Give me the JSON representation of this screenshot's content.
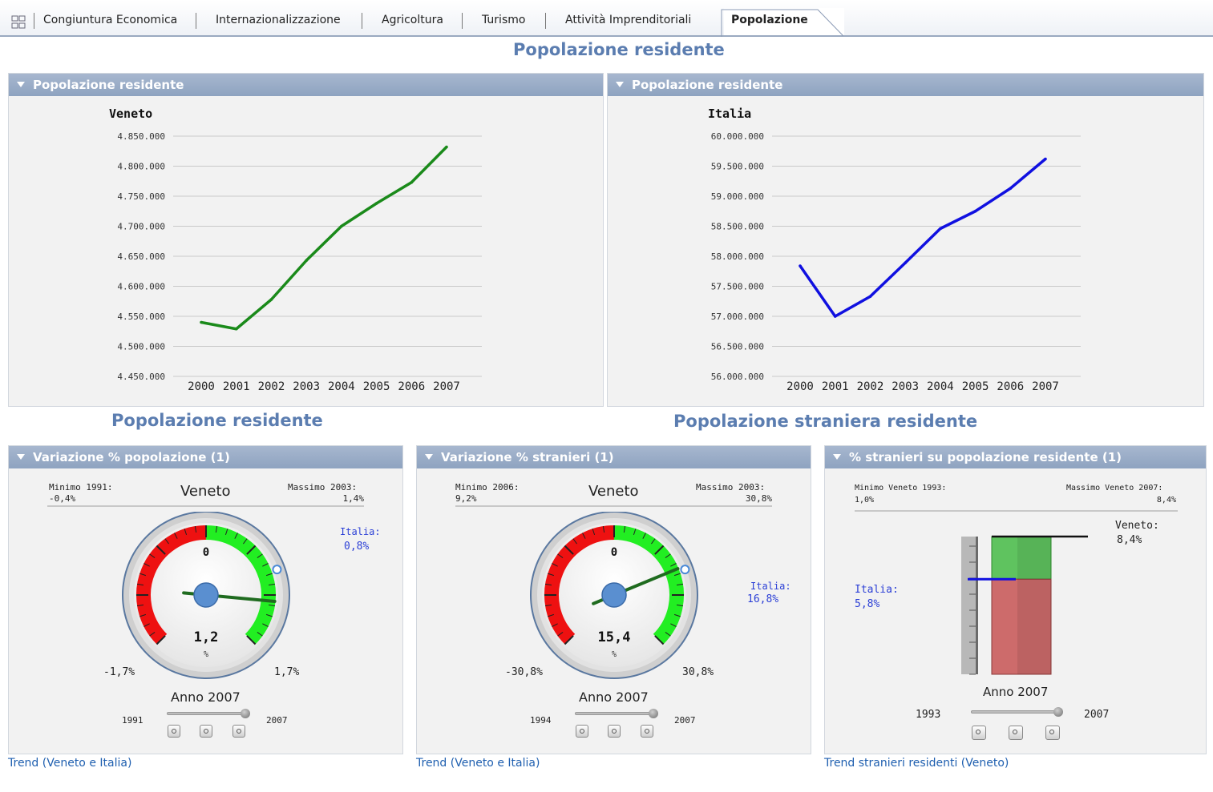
{
  "tabs": [
    {
      "label": "Congiuntura Economica"
    },
    {
      "label": "Internazionalizzazione"
    },
    {
      "label": "Agricoltura"
    },
    {
      "label": "Turismo"
    },
    {
      "label": "Attività Imprenditoriali"
    },
    {
      "label": "Popolazione"
    }
  ],
  "active_tab": "Popolazione",
  "headings": {
    "top": "Popolazione residente",
    "left": "Popolazione residente",
    "right": "Popolazione straniera residente"
  },
  "panels": {
    "chart_veneto_title": "Popolazione residente",
    "chart_italia_title": "Popolazione residente",
    "gauge1_title": "Variazione % popolazione (1)",
    "gauge2_title": "Variazione % stranieri (1)",
    "bar_title": "% stranieri su popolazione residente (1)"
  },
  "gauge1": {
    "min_label": "Minimo 1991:",
    "min_value": "-0,4%",
    "max_label": "Massimo 2003:",
    "max_value": "1,4%",
    "region": "Veneto",
    "italia_label": "Italia:",
    "italia_value": "0,8%",
    "zero": "0",
    "value": "1,2",
    "unit": "%",
    "scale_min": "-1,7%",
    "scale_max": "1,7%",
    "year_label": "Anno 2007",
    "slider_start": "1991",
    "slider_end": "2007",
    "needle_fraction": 0.853,
    "link": "Trend (Veneto e Italia)"
  },
  "gauge2": {
    "min_label": "Minimo 2006:",
    "min_value": "9,2%",
    "max_label": "Massimo 2003:",
    "max_value": "30,8%",
    "region": "Veneto",
    "italia_label": "Italia:",
    "italia_value": "16,8%",
    "zero": "0",
    "value": "15,4",
    "unit": "%",
    "scale_min": "-30,8%",
    "scale_max": "30,8%",
    "year_label": "Anno 2007",
    "slider_start": "1994",
    "slider_end": "2007",
    "needle_fraction": 0.75,
    "link": "Trend (Veneto e Italia)"
  },
  "barpanel": {
    "min_label": "Minimo Veneto 1993:",
    "min_value": "1,0%",
    "max_label": "Massimo Veneto 2007:",
    "max_value": "8,4%",
    "veneto_label": "Veneto:",
    "veneto_value": "8,4%",
    "italia_label": "Italia:",
    "italia_value": "5,8%",
    "year_label": "Anno 2007",
    "slider_start": "1993",
    "slider_end": "2007",
    "veneto_pct": 8.4,
    "italia_pct": 5.8,
    "link": "Trend stranieri residenti (Veneto)"
  },
  "colors": {
    "veneto_line": "#1a8a1a",
    "italia_line": "#1010e0",
    "heading": "#5b7db0",
    "gauge_red": "#ee1111",
    "gauge_green": "#22ee22"
  },
  "chart_data": [
    {
      "type": "line",
      "title": "Veneto",
      "categories": [
        "2000",
        "2001",
        "2002",
        "2003",
        "2004",
        "2005",
        "2006",
        "2007"
      ],
      "series": [
        {
          "values": [
            4540000,
            4529000,
            4578000,
            4643000,
            4700000,
            4738000,
            4773000,
            4832000
          ]
        }
      ],
      "yticks": [
        "4.850.000",
        "4.800.000",
        "4.750.000",
        "4.700.000",
        "4.650.000",
        "4.600.000",
        "4.550.000",
        "4.500.000",
        "4.450.000"
      ],
      "ylim": [
        4450000,
        4850000
      ],
      "grid": true
    },
    {
      "type": "line",
      "title": "Italia",
      "categories": [
        "2000",
        "2001",
        "2002",
        "2003",
        "2004",
        "2005",
        "2006",
        "2007"
      ],
      "series": [
        {
          "values": [
            57840000,
            57000000,
            57330000,
            57890000,
            58460000,
            58750000,
            59130000,
            59620000
          ]
        }
      ],
      "yticks": [
        "60.000.000",
        "59.500.000",
        "59.000.000",
        "58.500.000",
        "58.000.000",
        "57.500.000",
        "57.000.000",
        "56.500.000",
        "56.000.000"
      ],
      "ylim": [
        56000000,
        60000000
      ],
      "grid": true
    }
  ]
}
